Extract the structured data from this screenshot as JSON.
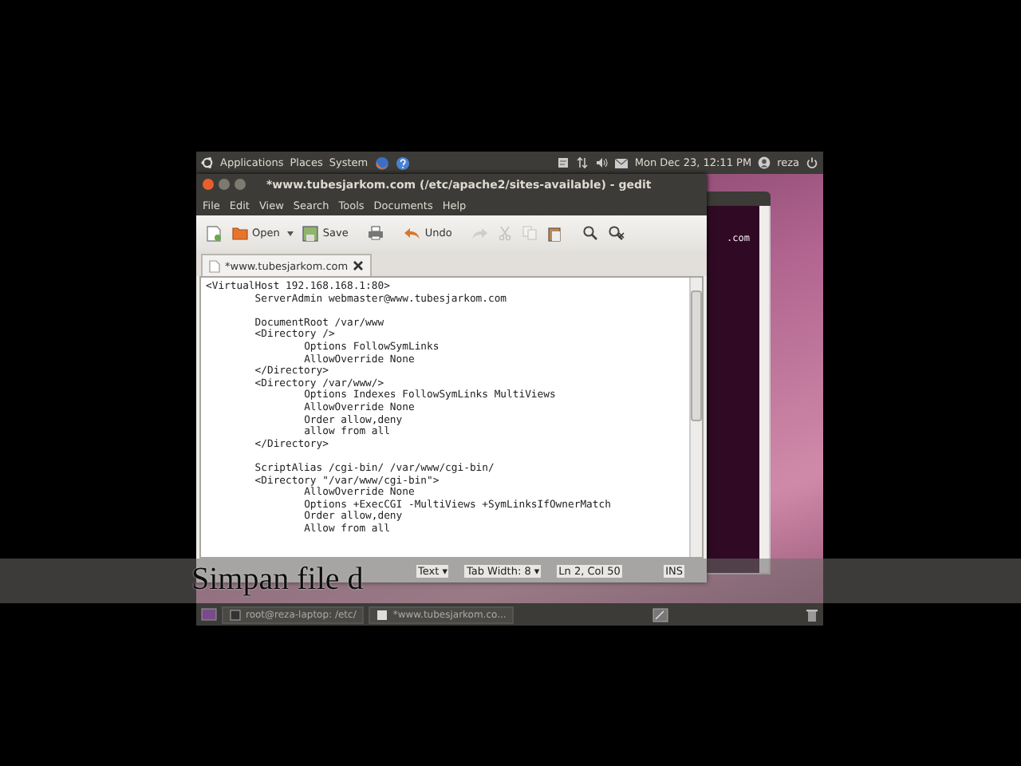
{
  "top_panel": {
    "menus": [
      "Applications",
      "Places",
      "System"
    ],
    "clock": "Mon Dec 23, 12:11 PM",
    "user": "reza"
  },
  "terminal": {
    "visible_text": ".com"
  },
  "gedit": {
    "title": "*www.tubesjarkom.com (/etc/apache2/sites-available) - gedit",
    "menu": [
      "File",
      "Edit",
      "View",
      "Search",
      "Tools",
      "Documents",
      "Help"
    ],
    "toolbar": [
      {
        "kind": "new",
        "disabled": false
      },
      {
        "kind": "open",
        "label": "Open",
        "disabled": false
      },
      {
        "kind": "save",
        "label": "Save",
        "disabled": false
      },
      {
        "kind": "print",
        "disabled": false
      },
      {
        "kind": "undo",
        "label": "Undo",
        "disabled": false
      },
      {
        "kind": "redo",
        "disabled": true
      },
      {
        "kind": "cut",
        "disabled": true
      },
      {
        "kind": "copy",
        "disabled": true
      },
      {
        "kind": "paste",
        "disabled": false
      },
      {
        "kind": "find",
        "disabled": false
      },
      {
        "kind": "replace",
        "disabled": false
      }
    ],
    "tabs": [
      {
        "label": "*www.tubesjarkom.com",
        "selected": true
      }
    ],
    "editor_blocks": [
      [
        "<VirtualHost 192.168.168.1:80>",
        "\tServerAdmin webmaster@www.tubesjarkom.com"
      ],
      [
        "\tDocumentRoot /var/www",
        "\t<Directory />",
        "\t\tOptions FollowSymLinks",
        "\t\tAllowOverride None",
        "\t</Directory>",
        "\t<Directory /var/www/>",
        "\t\tOptions Indexes FollowSymLinks MultiViews",
        "\t\tAllowOverride None",
        "\t\tOrder allow,deny",
        "\t\tallow from all",
        "\t</Directory>"
      ],
      [
        "\tScriptAlias /cgi-bin/ /var/www/cgi-bin/",
        "\t<Directory \"/var/www/cgi-bin\">",
        "\t\tAllowOverride None",
        "\t\tOptions +ExecCGI -MultiViews +SymLinksIfOwnerMatch",
        "\t\tOrder allow,deny",
        "\t\tAllow from all"
      ]
    ],
    "status_bar": [
      "Text ▾",
      "Tab Width: 8 ▾",
      "Ln 2, Col 50",
      "INS"
    ]
  },
  "taskbar": [
    "root@reza-laptop: /etc/",
    "*www.tubesjarkom.co..."
  ],
  "caption": "Simpan file d"
}
